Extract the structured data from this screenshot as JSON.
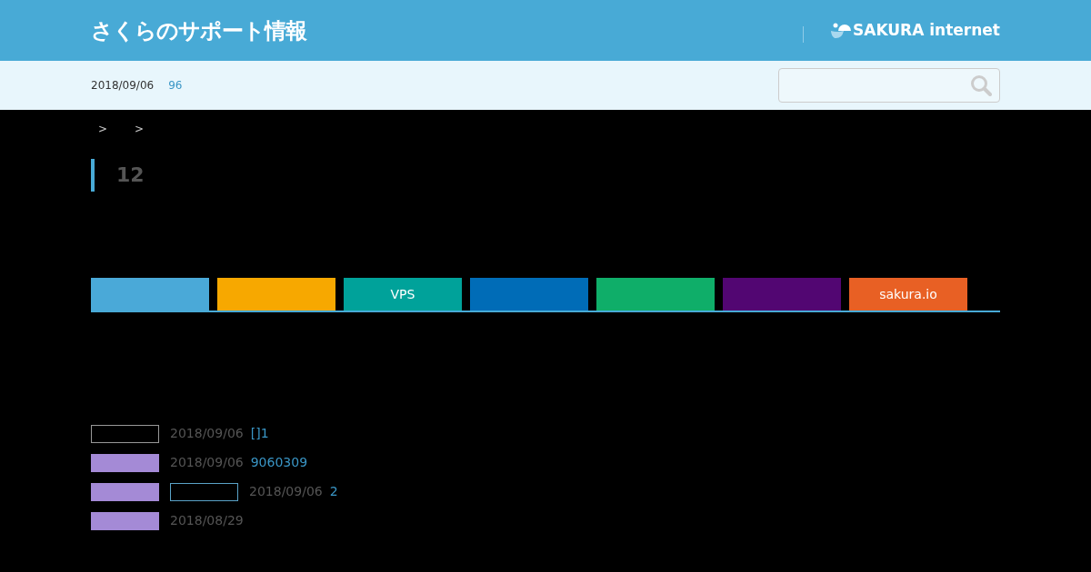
{
  "header": {
    "site_title": "さくらのサポート情報",
    "brand": "SAKURA internet"
  },
  "infobar": {
    "date": "2018/09/06",
    "count": "96"
  },
  "breadcrumb": [
    ">",
    ">"
  ],
  "heading": "12",
  "tabs": [
    {
      "color": "#4aa9d8"
    },
    {
      "color": "#f7a800"
    },
    {
      "color": "#00a29a",
      "label": "VPS"
    },
    {
      "color": "#006cb7"
    },
    {
      "color": "#0fae69"
    },
    {
      "color": "#520672"
    },
    {
      "color": "#e86024",
      "label": "sakura.io"
    }
  ],
  "news": [
    {
      "badges": [
        {
          "kind": "outline"
        }
      ],
      "date": "2018/09/06",
      "title": "[]1"
    },
    {
      "badges": [
        {
          "kind": "filled"
        }
      ],
      "date": "2018/09/06",
      "title": "9060309"
    },
    {
      "badges": [
        {
          "kind": "filled"
        },
        {
          "kind": "outline-accent"
        }
      ],
      "date": "2018/09/06",
      "title": "2"
    },
    {
      "badges": [
        {
          "kind": "filled"
        }
      ],
      "date": "2018/08/29"
    }
  ]
}
